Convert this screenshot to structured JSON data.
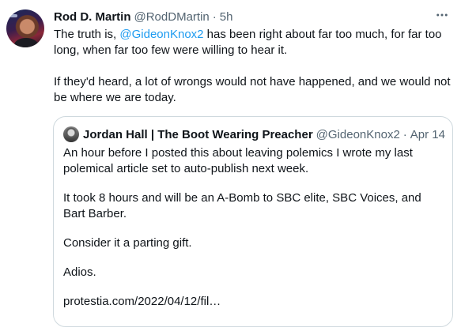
{
  "tweet": {
    "author_name": "Rod D. Martin",
    "author_handle": "@RodDMartin",
    "separator": "·",
    "time": "5h",
    "text": {
      "line1_prefix": "The truth is, ",
      "mention": "@GideonKnox2",
      "line1_suffix": " has been right about far too much, for far too long, when far too few were willing to hear it.",
      "paragraph2": "If they'd heard, a lot of wrongs would not have happened, and we would not be where we are today."
    },
    "more_icon": "ellipsis-icon"
  },
  "quoted_tweet": {
    "author_name": "Jordan Hall | The Boot Wearing Preacher",
    "author_handle": "@GideonKnox2",
    "separator": "·",
    "time": "Apr 14",
    "paragraphs": [
      "An hour before I posted this about leaving polemics I wrote my last polemical article set to auto-publish next week.",
      "It took 8 hours and will be an A-Bomb to SBC elite, SBC Voices, and Bart Barber.",
      "Consider it a parting gift.",
      "Adios.",
      "protestia.com/2022/04/12/fil…"
    ]
  },
  "colors": {
    "text": "#0f1419",
    "secondary": "#536471",
    "link": "#1d9bf0",
    "border": "#cfd9de"
  }
}
